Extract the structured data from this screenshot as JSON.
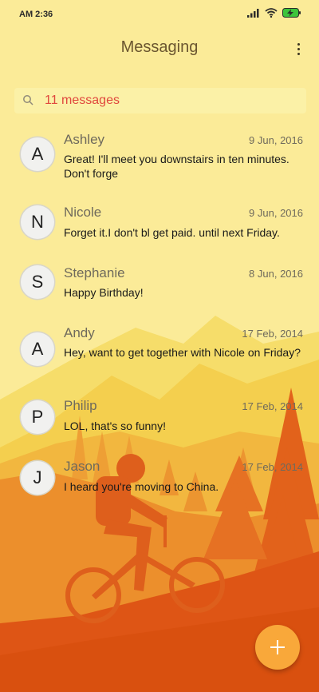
{
  "status_bar": {
    "time": "AM 2:36"
  },
  "header": {
    "title": "Messaging"
  },
  "search": {
    "label": "11 messages"
  },
  "messages": [
    {
      "initial": "A",
      "name": "Ashley",
      "date": "9 Jun, 2016",
      "text": "Great! I'll meet you downstairs in ten minutes. Don't forge"
    },
    {
      "initial": "N",
      "name": "Nicole",
      "date": "9 Jun, 2016",
      "text": "Forget it.I don't bl get paid. until next Friday."
    },
    {
      "initial": "S",
      "name": "Stephanie",
      "date": "8 Jun, 2016",
      "text": "Happy Birthday!"
    },
    {
      "initial": "A",
      "name": "Andy",
      "date": "17 Feb, 2014",
      "text": "Hey, want to get together with Nicole on Friday?"
    },
    {
      "initial": "P",
      "name": "Philip",
      "date": "17 Feb, 2014",
      "text": "LOL, that's so funny!"
    },
    {
      "initial": "J",
      "name": "Jason",
      "date": "17 Feb, 2014",
      "text": "I heard you're moving to China."
    }
  ],
  "colors": {
    "background": "#fbeb98",
    "search_text": "#e0483e",
    "fab": "#f9a83a"
  },
  "icons": {
    "more": "more-vert-icon",
    "search": "search-icon",
    "compose": "plus-icon",
    "signal": "signal-icon",
    "wifi": "wifi-icon",
    "battery": "battery-charging-icon"
  }
}
